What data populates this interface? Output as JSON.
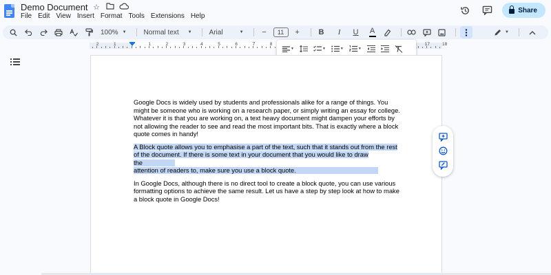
{
  "document": {
    "title": "Demo Document"
  },
  "title_icons": [
    "star-icon",
    "folder-move-icon",
    "cloud-status-icon"
  ],
  "menu": [
    "File",
    "Edit",
    "View",
    "Insert",
    "Format",
    "Tools",
    "Extensions",
    "Help"
  ],
  "header_right": {
    "history_icon": "history-icon",
    "comments_icon": "comment-icon",
    "share_label": "Share"
  },
  "toolbar": {
    "zoom": "100%",
    "style": "Normal text",
    "font": "Arial",
    "font_size": "11",
    "minus": "−",
    "plus": "+",
    "bold": "B",
    "italic": "I",
    "underline": "U",
    "text_color": "A"
  },
  "ruler": {
    "labels": [
      {
        "v": "2"
      },
      {
        "v": "1"
      },
      {
        "v": "1"
      },
      {
        "v": "2"
      },
      {
        "v": "3"
      },
      {
        "v": "4"
      },
      {
        "v": "5"
      },
      {
        "v": "6"
      },
      {
        "v": "7"
      },
      {
        "v": "8"
      },
      {
        "v": "9"
      },
      {
        "v": "10"
      },
      {
        "v": "11"
      },
      {
        "v": "12"
      },
      {
        "v": "13"
      },
      {
        "v": "14"
      },
      {
        "v": "15"
      },
      {
        "v": "16"
      },
      {
        "v": "17"
      },
      {
        "v": "18"
      }
    ]
  },
  "content": {
    "paragraph1": "Google Docs is widely used by students and professionals alike for a range of things. You might be someone who is working on a research paper, or simply writing an essay for college. Whatever it is that you are working on, a text heavy document might dampen your efforts by not allowing the reader to see and read the most important bits. That is exactly where a block quote comes in handy!",
    "paragraph2_lines": [
      "A Block quote allows you to emphasise a part of the text, such that it stands out from the rest",
      "of the document. If there is some text in your document that you would like to draw the",
      "attention of readers to, make sure you use a block quote."
    ],
    "paragraph3": "In Google Docs, although there is no direct tool to create a block quote, you can use various formatting options to achieve the same result. Let us have a step by step look at how to make a block quote in Google Docs!"
  },
  "colors": {
    "accent": "#1a73e8",
    "share_bg": "#c2e7ff",
    "highlight": "#c2d7f6",
    "toolbar_bg": "#edf2fa"
  }
}
